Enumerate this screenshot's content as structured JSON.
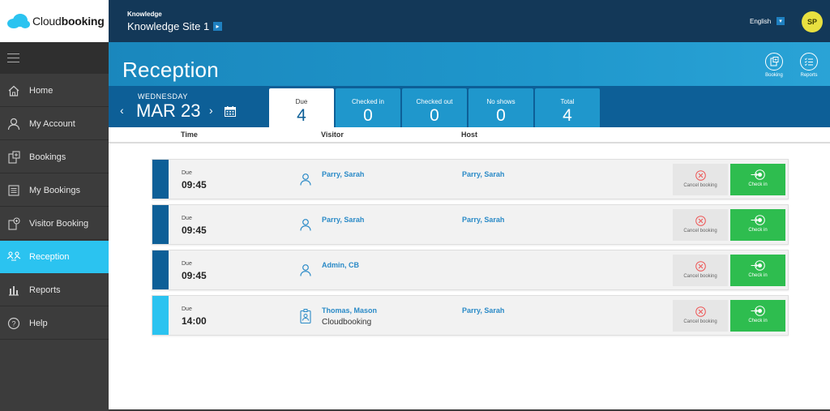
{
  "logo": {
    "name_light": "Cloud",
    "name_bold": "booking"
  },
  "sidebar": {
    "items": [
      {
        "label": "Home",
        "icon": "home-icon"
      },
      {
        "label": "My Account",
        "icon": "user-icon"
      },
      {
        "label": "Bookings",
        "icon": "bookings-icon"
      },
      {
        "label": "My Bookings",
        "icon": "my-bookings-icon"
      },
      {
        "label": "Visitor Booking",
        "icon": "visitor-booking-icon"
      },
      {
        "label": "Reception",
        "icon": "reception-icon",
        "active": true
      },
      {
        "label": "Reports",
        "icon": "reports-icon"
      },
      {
        "label": "Help",
        "icon": "help-icon"
      }
    ]
  },
  "topbar": {
    "site_label": "Knowledge",
    "site_name": "Knowledge Site 1",
    "language": "English",
    "avatar_initials": "SP"
  },
  "header": {
    "title": "Reception",
    "buttons": [
      {
        "label": "Booking",
        "icon": "booking-icon"
      },
      {
        "label": "Reports",
        "icon": "reports-list-icon"
      }
    ]
  },
  "date": {
    "weekday": "WEDNESDAY",
    "date": "MAR 23"
  },
  "tabs": [
    {
      "label": "Due",
      "count": "4",
      "active": true
    },
    {
      "label": "Checked in",
      "count": "0"
    },
    {
      "label": "Checked out",
      "count": "0"
    },
    {
      "label": "No shows",
      "count": "0"
    },
    {
      "label": "Total",
      "count": "4"
    }
  ],
  "columns": {
    "time": "Time",
    "visitor": "Visitor",
    "host": "Host"
  },
  "rows": [
    {
      "status": "Due",
      "time": "09:45",
      "visitor": "Parry, Sarah",
      "company": "",
      "host": "Parry, Sarah",
      "visitor_icon": "person-icon",
      "bar_color": "#0d5f97"
    },
    {
      "status": "Due",
      "time": "09:45",
      "visitor": "Parry, Sarah",
      "company": "",
      "host": "Parry, Sarah",
      "visitor_icon": "person-icon",
      "bar_color": "#0d5f97"
    },
    {
      "status": "Due",
      "time": "09:45",
      "visitor": "Admin, CB",
      "company": "",
      "host": "",
      "visitor_icon": "person-icon",
      "bar_color": "#0d5f97"
    },
    {
      "status": "Due",
      "time": "14:00",
      "visitor": "Thomas, Mason",
      "company": "Cloudbooking",
      "host": "Parry, Sarah",
      "visitor_icon": "badge-icon",
      "bar_color": "#2bc3f0"
    }
  ],
  "actions": {
    "cancel_label": "Cancel booking",
    "checkin_label": "Check in"
  },
  "colors": {
    "accent": "#2bc3f0",
    "navy": "#133858",
    "checkin": "#2ebd4f"
  }
}
